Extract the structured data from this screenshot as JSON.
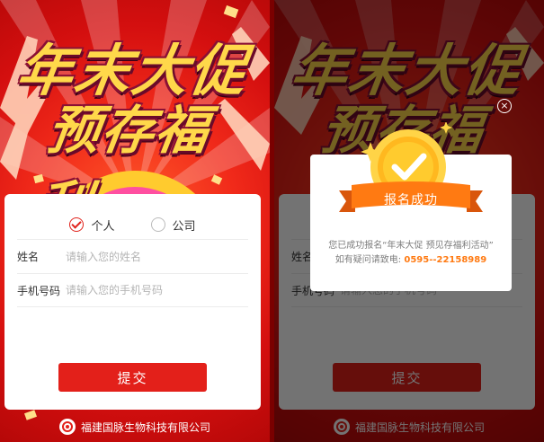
{
  "campaign": {
    "title_line1": "年末大促",
    "title_line2": "预存福利"
  },
  "form": {
    "radio_options": [
      "个人",
      "公司"
    ],
    "selected_option": "个人",
    "name_label": "姓名",
    "name_placeholder": "请输入您的姓名",
    "phone_label": "手机号码",
    "phone_placeholder": "请输入您的手机号码",
    "submit_label": "提交"
  },
  "footer": {
    "company": "福建国脉生物科技有限公司"
  },
  "modal": {
    "ribbon_text": "报名成功",
    "message_line1": "您已成功报名“年末大促 预见存福利活动”",
    "message_line2_prefix": "如有疑问请致电:",
    "phone": "0595--22158989",
    "close_symbol": "×"
  },
  "colors": {
    "brand_red": "#e3201a",
    "title_yellow": "#ffd84a",
    "accent_orange": "#ff7a12"
  }
}
